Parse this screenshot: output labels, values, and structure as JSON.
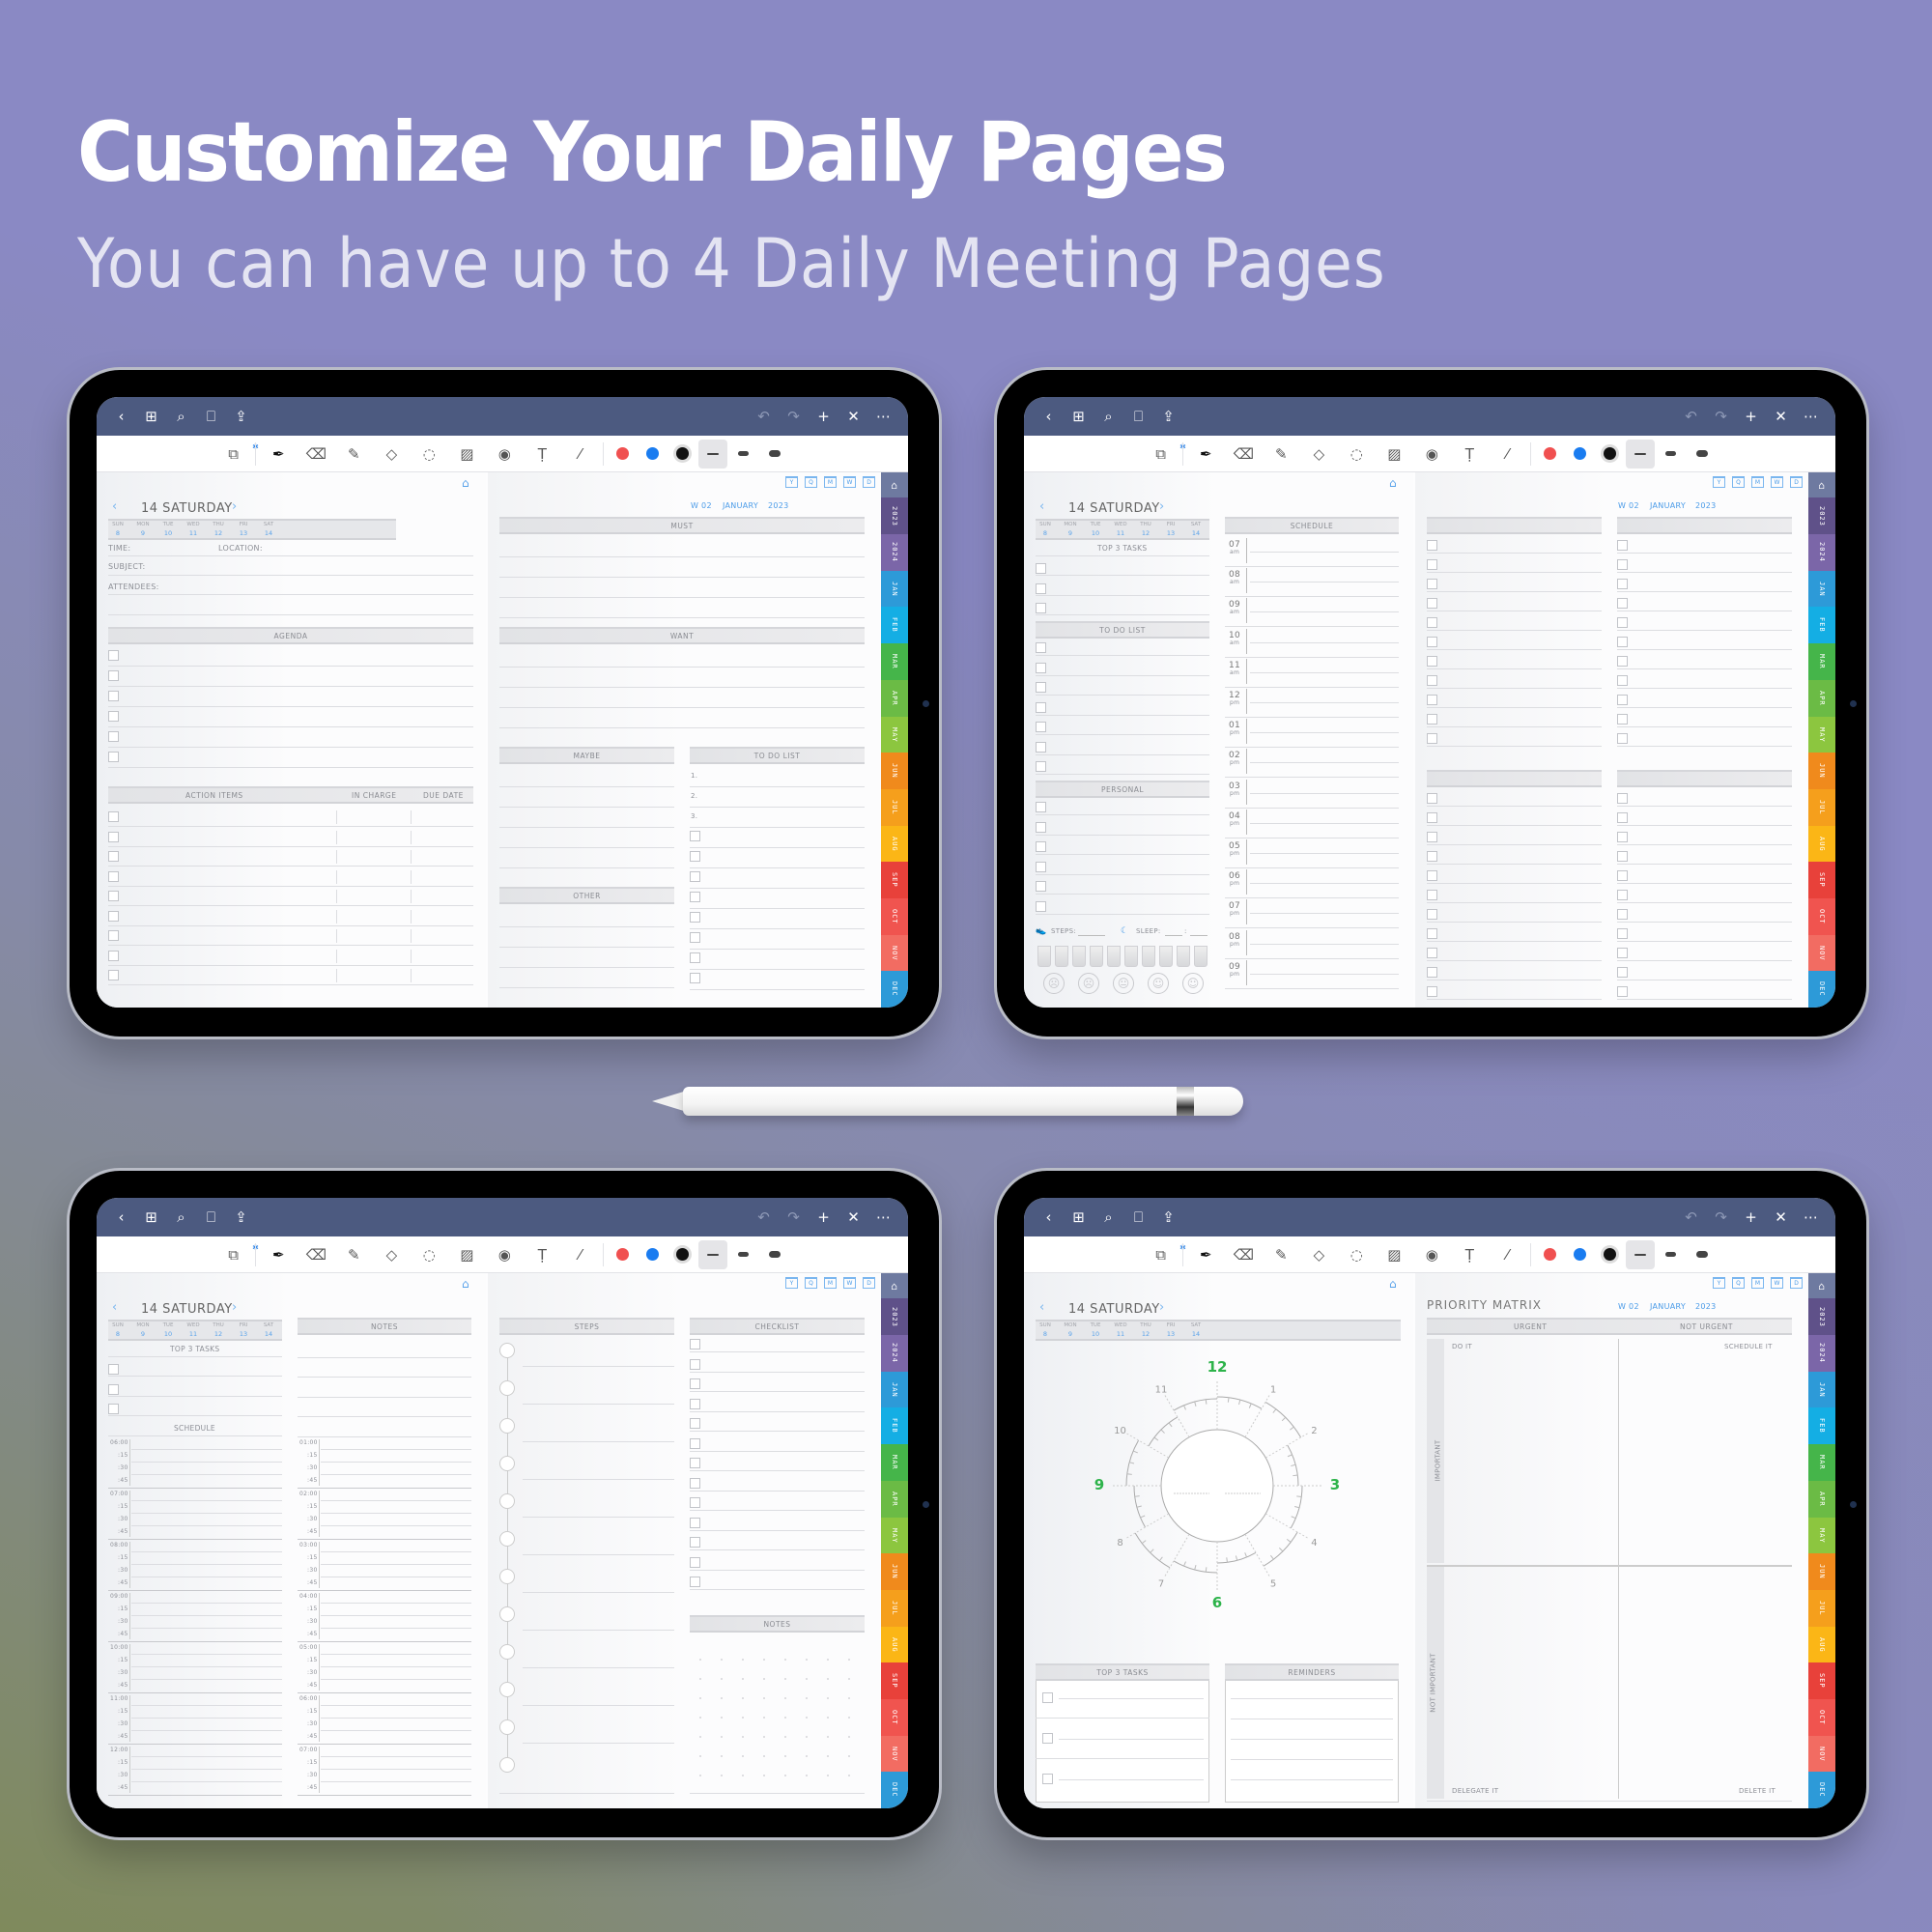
{
  "headline": "Customize Your Daily Pages",
  "subline": "You can have up to 4 Daily Meeting Pages",
  "colors": {
    "topbar": "#4c5a80",
    "accent_blue": "#4a9be8",
    "clock_green": "#2db34a",
    "pen_red": "#f05050",
    "pen_blue": "#1a7cf0",
    "pen_black": "#111111"
  },
  "app": {
    "topbar_left_icons": [
      "back-icon",
      "grid-icon",
      "search-icon",
      "bookmark-icon",
      "share-icon"
    ],
    "topbar_right_icons": [
      "undo-icon",
      "redo-icon",
      "add-icon",
      "close-icon",
      "more-icon"
    ],
    "glyphs": {
      "back": "‹",
      "grid": "⊞",
      "search": "⌕",
      "bookmark": "⎕",
      "share": "⇪",
      "undo": "↶",
      "redo": "↷",
      "add": "+",
      "close": "✕",
      "more": "⋯"
    },
    "tools": [
      {
        "name": "page-view-tool",
        "glyph": "⧉"
      },
      {
        "name": "pen-tool",
        "glyph": "✒"
      },
      {
        "name": "eraser-tool",
        "glyph": "⌫"
      },
      {
        "name": "highlighter-tool",
        "glyph": "✎"
      },
      {
        "name": "shapes-tool",
        "glyph": "◇"
      },
      {
        "name": "lasso-tool",
        "glyph": "◌"
      },
      {
        "name": "image-tool",
        "glyph": "▨"
      },
      {
        "name": "camera-tool",
        "glyph": "◉"
      },
      {
        "name": "text-tool",
        "glyph": "Ṭ"
      },
      {
        "name": "laser-tool",
        "glyph": "⁄"
      }
    ],
    "bluetooth_glyph": "✱",
    "view_icons": [
      "Y",
      "Q",
      "M",
      "W",
      "D"
    ],
    "home_glyph": "⌂",
    "tabs": [
      {
        "label": "⌂",
        "color": "#6e7aa0"
      },
      {
        "label": "2023",
        "color": "#5f5189"
      },
      {
        "label": "2024",
        "color": "#7b66a8"
      },
      {
        "label": "JAN",
        "color": "#2d9ad8"
      },
      {
        "label": "FEB",
        "color": "#14aee4"
      },
      {
        "label": "MAR",
        "color": "#45b54a"
      },
      {
        "label": "APR",
        "color": "#6bbb45"
      },
      {
        "label": "MAY",
        "color": "#8cc63f"
      },
      {
        "label": "JUN",
        "color": "#f08a1c"
      },
      {
        "label": "JUL",
        "color": "#f59f1c"
      },
      {
        "label": "AUG",
        "color": "#fbb616"
      },
      {
        "label": "SEP",
        "color": "#e8413a"
      },
      {
        "label": "OCT",
        "color": "#f0544f"
      },
      {
        "label": "NOV",
        "color": "#f26c62"
      },
      {
        "label": "DEC",
        "color": "#2d9ad8"
      }
    ]
  },
  "date": {
    "title": "14 SATURDAY",
    "prev": "‹",
    "next": "›",
    "week_label": "W 02",
    "month": "JANUARY",
    "year": "2023",
    "weekdays": [
      "SUN",
      "MON",
      "TUE",
      "WED",
      "THU",
      "FRI",
      "SAT"
    ],
    "daynums": [
      "8",
      "9",
      "10",
      "11",
      "12",
      "13",
      "14"
    ]
  },
  "page1": {
    "fields": {
      "time": "TIME:",
      "location": "LOCATION:",
      "subject": "SUBJECT:",
      "attendees": "ATTENDEES:"
    },
    "agenda": "AGENDA",
    "action_items": "ACTION ITEMS",
    "in_charge": "IN CHARGE",
    "due_date": "DUE DATE",
    "must": "MUST",
    "want": "WANT",
    "maybe": "MAYBE",
    "other": "OTHER",
    "todo": "TO DO LIST",
    "todo_numbers": [
      "1.",
      "2.",
      "3."
    ]
  },
  "page2": {
    "top3": "TOP 3 TASKS",
    "todo": "TO DO LIST",
    "personal": "PERSONAL",
    "schedule": "SCHEDULE",
    "steps": "STEPS:",
    "sleep": "SLEEP:",
    "sleep_sep": ":",
    "hours": [
      {
        "h": "07",
        "p": "am"
      },
      {
        "h": "08",
        "p": "am"
      },
      {
        "h": "09",
        "p": "am"
      },
      {
        "h": "10",
        "p": "am"
      },
      {
        "h": "11",
        "p": "am"
      },
      {
        "h": "12",
        "p": "pm"
      },
      {
        "h": "01",
        "p": "pm"
      },
      {
        "h": "02",
        "p": "pm"
      },
      {
        "h": "03",
        "p": "pm"
      },
      {
        "h": "04",
        "p": "pm"
      },
      {
        "h": "05",
        "p": "pm"
      },
      {
        "h": "06",
        "p": "pm"
      },
      {
        "h": "07",
        "p": "pm"
      },
      {
        "h": "08",
        "p": "pm"
      },
      {
        "h": "09",
        "p": "pm"
      }
    ],
    "water_glasses": 10,
    "moods": [
      "☹",
      "☹",
      "😐",
      "☺",
      "☺"
    ]
  },
  "page3": {
    "top3": "TOP 3 TASKS",
    "schedule": "SCHEDULE",
    "notes": "NOTES",
    "steps": "STEPS",
    "checklist": "CHECKLIST",
    "notes2": "NOTES",
    "left_hours": [
      "06:00",
      "07:00",
      "08:00",
      "09:00",
      "10:00",
      "11:00",
      "12:00"
    ],
    "right_hours": [
      "01:00",
      "02:00",
      "03:00",
      "04:00",
      "05:00",
      "06:00",
      "07:00"
    ],
    "quarters": [
      ":15",
      ":30",
      ":45"
    ]
  },
  "page4": {
    "title": "PRIORITY MATRIX",
    "urgent": "URGENT",
    "not_urgent": "NOT URGENT",
    "important": "IMPORTANT",
    "not_important": "NOT IMPORTANT",
    "do_it": "DO IT",
    "schedule_it": "SCHEDULE IT",
    "delegate_it": "DELEGATE IT",
    "delete_it": "DELETE IT",
    "top3": "TOP 3 TASKS",
    "reminders": "REMINDERS",
    "clock_numbers": [
      "12",
      "1",
      "2",
      "3",
      "4",
      "5",
      "6",
      "7",
      "8",
      "9",
      "10",
      "11"
    ],
    "clock_highlight": [
      "12",
      "3",
      "6",
      "9"
    ]
  }
}
